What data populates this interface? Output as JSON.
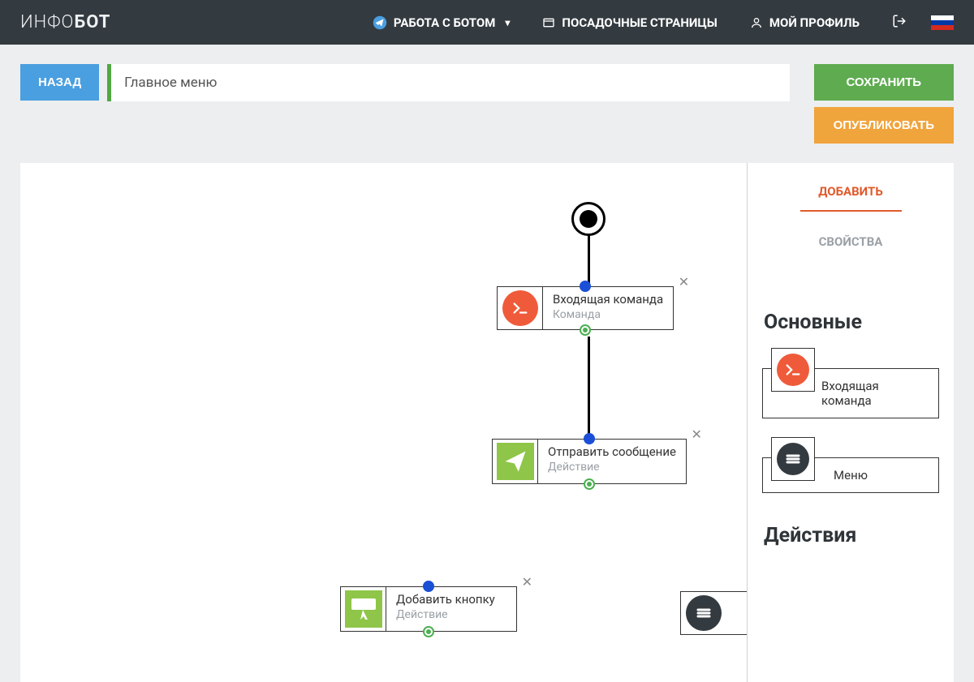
{
  "header": {
    "logo_thin": "ИНФО",
    "logo_bold": "БОТ",
    "nav_bot": "РАБОТА С БОТОМ",
    "nav_landing": "ПОСАДОЧНЫЕ СТРАНИЦЫ",
    "nav_profile": "МОЙ ПРОФИЛЬ"
  },
  "toolbar": {
    "back": "НАЗАД",
    "title": "Главное меню",
    "save": "СОХРАНИТЬ",
    "publish": "ОПУБЛИКОВАТЬ"
  },
  "sidebar": {
    "tab_add": "ДОБАВИТЬ",
    "tab_props": "СВОЙСТВА",
    "section_main": "Основные",
    "section_actions": "Действия",
    "palette": {
      "incoming": "Входящая команда",
      "menu": "Меню"
    }
  },
  "nodes": {
    "incoming": {
      "title": "Входящая команда",
      "sub": "Команда"
    },
    "send": {
      "title": "Отправить сообщение",
      "sub": "Действие"
    },
    "addbtn": {
      "title": "Добавить кнопку",
      "sub": "Действие"
    }
  }
}
